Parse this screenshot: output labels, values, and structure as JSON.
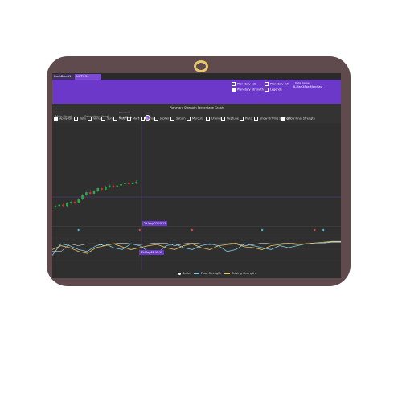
{
  "tabs": [
    {
      "label": "DashBoard1"
    },
    {
      "label": "NIFTY 50"
    }
  ],
  "header": {
    "checkboxes_top": [
      {
        "label": "Planetary E/S",
        "checked": false
      },
      {
        "label": "Planetary Info",
        "checked": false
      },
      {
        "label": "Planetary Strength",
        "checked": true
      },
      {
        "label": "Legends",
        "checked": false
      }
    ],
    "date_label": "Data Range",
    "date_value": "8-Mar-28se/Mon/day"
  },
  "graph": {
    "title": "Planetary Strength Percentage Graph",
    "main_planet": "Main Planet",
    "secondary_planet": "Secondary Planet",
    "direction_label": "Directions",
    "direction_value": "Key/High"
  },
  "planet_checkboxes": [
    {
      "label": "Apply ISE",
      "checked": true
    },
    {
      "label": "Ketu",
      "checked": false
    },
    {
      "label": "Venus",
      "checked": false
    },
    {
      "label": "Sun",
      "checked": false
    },
    {
      "label": "Moon",
      "checked": false
    },
    {
      "label": "Mars",
      "checked": false
    },
    {
      "label": "Rahu",
      "checked": false
    },
    {
      "label": "Jupiter",
      "checked": false
    },
    {
      "label": "Saturn",
      "checked": false
    },
    {
      "label": "Mercury",
      "checked": false
    },
    {
      "label": "Uranus",
      "checked": false
    },
    {
      "label": "Neptune",
      "checked": false
    },
    {
      "label": "Pluto",
      "checked": false
    },
    {
      "label": "Show Driving Strength",
      "checked": false
    },
    {
      "label": "Show Final Strength",
      "checked": true
    }
  ],
  "tooltips": {
    "main": "29-May-22 15:13",
    "lower": "29-May-22 15:13"
  },
  "legend": [
    {
      "label": "Series",
      "color": "#ffffff"
    },
    {
      "label": "Final Strength",
      "color": "#7ec8e3"
    },
    {
      "label": "Driving Strength",
      "color": "#e9c46a"
    }
  ],
  "colors": {
    "accent": "#6b38c9",
    "bull": "#2ea84a",
    "bear": "#d9303a",
    "final_strength": "#7ec8e3",
    "driving_strength": "#e9c46a",
    "frame": "#5f4a4e"
  },
  "chart_data": {
    "type": "line",
    "candles": [
      {
        "o": 3,
        "c": 4,
        "h": 5,
        "l": 2
      },
      {
        "o": 4,
        "c": 5,
        "h": 6,
        "l": 3
      },
      {
        "o": 5,
        "c": 4,
        "h": 6,
        "l": 3
      },
      {
        "o": 4,
        "c": 6,
        "h": 7,
        "l": 3
      },
      {
        "o": 6,
        "c": 7,
        "h": 8,
        "l": 5
      },
      {
        "o": 7,
        "c": 6,
        "h": 8,
        "l": 5
      },
      {
        "o": 6,
        "c": 9,
        "h": 10,
        "l": 6
      },
      {
        "o": 9,
        "c": 12,
        "h": 13,
        "l": 8
      },
      {
        "o": 12,
        "c": 14,
        "h": 15,
        "l": 11
      },
      {
        "o": 14,
        "c": 13,
        "h": 16,
        "l": 12
      },
      {
        "o": 13,
        "c": 15,
        "h": 16,
        "l": 12
      },
      {
        "o": 15,
        "c": 17,
        "h": 18,
        "l": 14
      },
      {
        "o": 17,
        "c": 16,
        "h": 18,
        "l": 15
      },
      {
        "o": 16,
        "c": 18,
        "h": 19,
        "l": 15
      },
      {
        "o": 18,
        "c": 19,
        "h": 20,
        "l": 17
      },
      {
        "o": 19,
        "c": 18,
        "h": 20,
        "l": 17
      },
      {
        "o": 18,
        "c": 19,
        "h": 21,
        "l": 17
      },
      {
        "o": 19,
        "c": 20,
        "h": 21,
        "l": 18
      },
      {
        "o": 20,
        "c": 21,
        "h": 22,
        "l": 19
      },
      {
        "o": 21,
        "c": 20,
        "h": 22,
        "l": 19
      },
      {
        "o": 20,
        "c": 21,
        "h": 22,
        "l": 20
      },
      {
        "o": 21,
        "c": 22,
        "h": 23,
        "l": 20
      }
    ],
    "series": [
      {
        "name": "Series",
        "values": [
          40,
          40,
          60,
          55,
          60,
          60,
          55,
          60,
          62,
          60,
          58,
          60,
          62,
          62,
          55,
          60,
          62,
          60,
          58,
          60,
          60,
          62,
          55,
          58,
          62,
          60,
          60,
          62,
          60,
          60,
          62,
          62,
          65,
          65
        ]
      },
      {
        "name": "Final Strength",
        "values": [
          30,
          60,
          55,
          45,
          40,
          55,
          60,
          50,
          45,
          60,
          55,
          40,
          35,
          55,
          60,
          50,
          45,
          55,
          60,
          55,
          40,
          45,
          60,
          55,
          50,
          45,
          55,
          50,
          55,
          60,
          62,
          62,
          64,
          64
        ]
      },
      {
        "name": "Driving Strength",
        "values": [
          45,
          55,
          50,
          40,
          35,
          50,
          55,
          60,
          52,
          45,
          50,
          55,
          58,
          50,
          45,
          55,
          60,
          50,
          45,
          55,
          58,
          60,
          52,
          50,
          45,
          55,
          58,
          60,
          58,
          60,
          62,
          64,
          66,
          66
        ]
      }
    ],
    "markers": [
      {
        "i": 3,
        "color": "#3dbcd6"
      },
      {
        "i": 10,
        "color": "#e04040"
      },
      {
        "i": 16,
        "color": "#e04040"
      },
      {
        "i": 24,
        "color": "#3dbcd6"
      },
      {
        "i": 30,
        "color": "#e04040"
      },
      {
        "i": 31,
        "color": "#3dbcd6"
      }
    ]
  }
}
